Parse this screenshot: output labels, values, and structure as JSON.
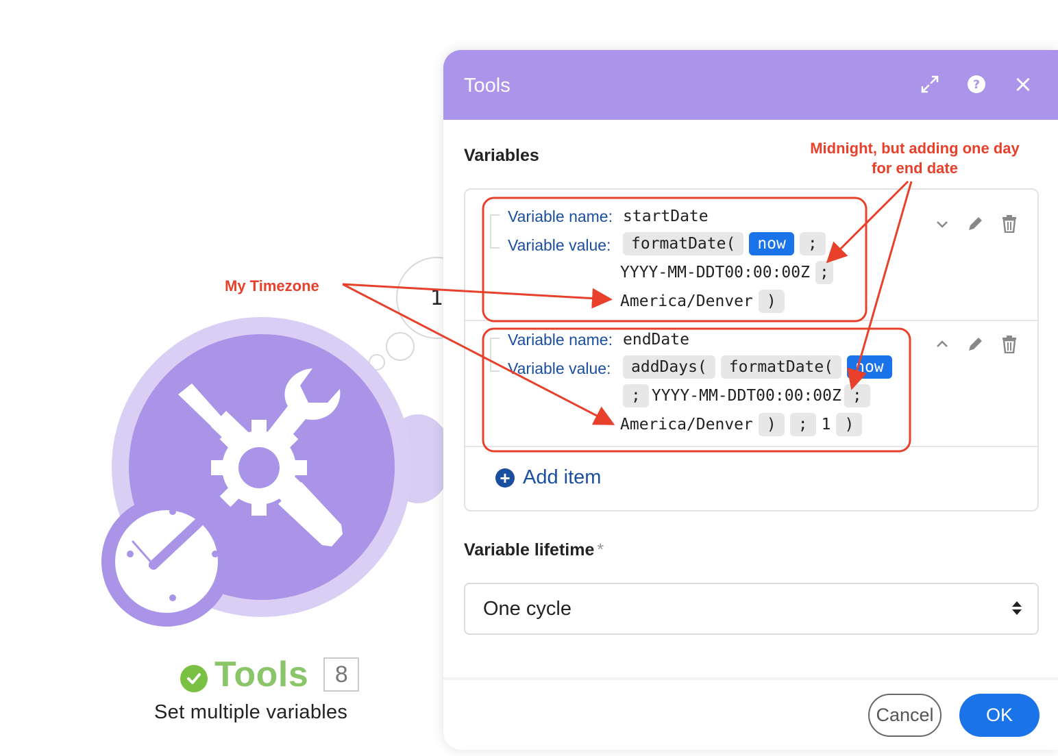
{
  "canvas": {
    "bubble_number": "1",
    "module": {
      "name": "Tools",
      "badge": "8",
      "subtitle": "Set multiple variables",
      "icon": "tools-icon",
      "status_icon": "check-icon",
      "accent_color": "#a994e8"
    }
  },
  "dialog": {
    "title": "Tools",
    "header_color": "#ab95ea",
    "header_buttons": [
      "expand-icon",
      "help-icon",
      "close-icon"
    ],
    "close_glyph": "×",
    "variables_label": "Variables",
    "items": [
      {
        "name_label": "Variable name:",
        "name": "startDate",
        "value_label": "Variable value:",
        "line1": [
          "formatDate(",
          "now",
          ";"
        ],
        "line2_text": "YYYY-MM-DDT00:00:00Z",
        "line2_tok": ";",
        "line3_text": "America/Denver",
        "line3_tok": ")"
      },
      {
        "name_label": "Variable name:",
        "name": "endDate",
        "value_label": "Variable value:",
        "line1": [
          "addDays(",
          "formatDate(",
          "now"
        ],
        "line2_tok_a": ";",
        "line2_text": "YYYY-MM-DDT00:00:00Z",
        "line2_tok_b": ";",
        "line3_text": "America/Denver",
        "line3_tok_a": ")",
        "line3_tok_b": ";",
        "line3_num": "1",
        "line3_tok_c": ")"
      }
    ],
    "add_item_label": "Add item",
    "lifetime_label": "Variable lifetime",
    "required_mark": "*",
    "lifetime_value": "One cycle",
    "cancel_label": "Cancel",
    "ok_label": "OK",
    "primary_color": "#1a73e8"
  },
  "annotations": {
    "timezone_note": "My Timezone",
    "midnight_note": "Midnight, but adding one day for end date",
    "color": "#e8402a"
  }
}
